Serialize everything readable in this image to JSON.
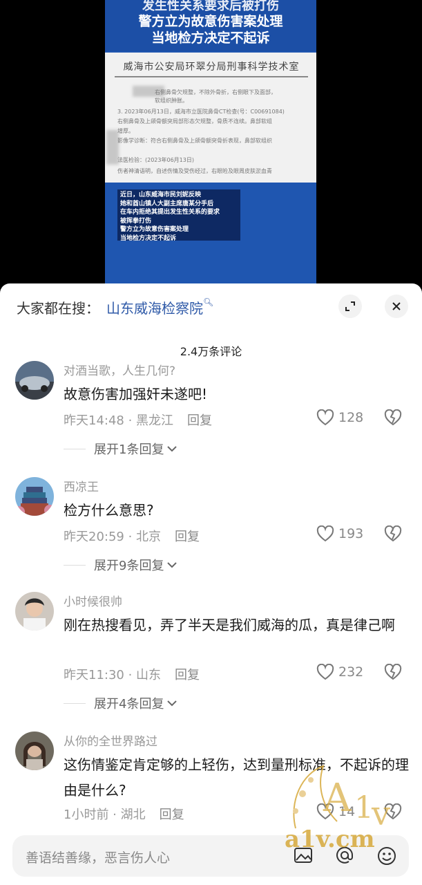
{
  "video": {
    "headline": [
      "发生性关系要求后被打伤",
      "警方立为故意伤害案处理",
      "当地检方决定不起诉"
    ],
    "doc_title": "威海市公安局环翠分局刑事科学技术室",
    "doc_lines": [
      "右侧鼻骨欠规整，不除外骨折，右侧眼下及面部，",
      "软组织肿胀。",
      "3. 2023年06月13日，威海市立医院鼻骨CT检查(号：C00691084)",
      "右侧鼻骨及上颌骨额突局部形态欠规整，骨质不连续。鼻部软组",
      "增厚。",
      "影像学诊断：符合右侧鼻骨及上颌骨额突骨折表现，鼻部软组织",
      "",
      "法医检验：(2023年06月13日)",
      "伤者神清语明，自述伤情及受伤经过，右眼睑及眼周皮肤淤血青"
    ],
    "caption": [
      "近日，山东威海市民刘妮反映",
      "她和酋山镇人大副主席唐某分手后",
      "在车内拒绝其提出发生性关系的要求",
      "被挥拳打伤",
      "警方立为故意伤害案处理",
      "当地检方决定不起诉"
    ]
  },
  "sheet": {
    "hot_label": "大家都在搜：",
    "hot_keyword": "山东威海检察院",
    "count": "2.4万条评论"
  },
  "comments": [
    {
      "name": "对酒当歌，人生几何?",
      "text": "故意伤害加强奸未遂吧!",
      "time": "昨天14:48 · 黑龙江",
      "reply": "回复",
      "likes": "128",
      "expand": "展开1条回复"
    },
    {
      "name": "西凉王",
      "text": "检方什么意思?",
      "time": "昨天20:59 · 北京",
      "reply": "回复",
      "likes": "193",
      "expand": "展开9条回复"
    },
    {
      "name": "小时候很帅",
      "text": "刚在热搜看见，弄了半天是我们威海的瓜，真是律己啊",
      "time": "昨天11:30 · 山东",
      "reply": "回复",
      "likes": "232",
      "expand": "展开4条回复"
    },
    {
      "name": "从你的全世界路过",
      "text": "这伤情鉴定肯定够的上轻伤，达到量刑标准，不起诉的理由是什么?",
      "time": "1小时前 · 湖北",
      "reply": "回复",
      "likes": "14",
      "expand": ""
    }
  ],
  "input": {
    "placeholder": "善语结善缘，恶言伤人心"
  },
  "watermark": {
    "logo": "A1v",
    "site": "a1v.cm"
  },
  "colors": {
    "keyword": "#2f5aa8",
    "meta": "#999999",
    "watermark": "#d6a93a"
  }
}
